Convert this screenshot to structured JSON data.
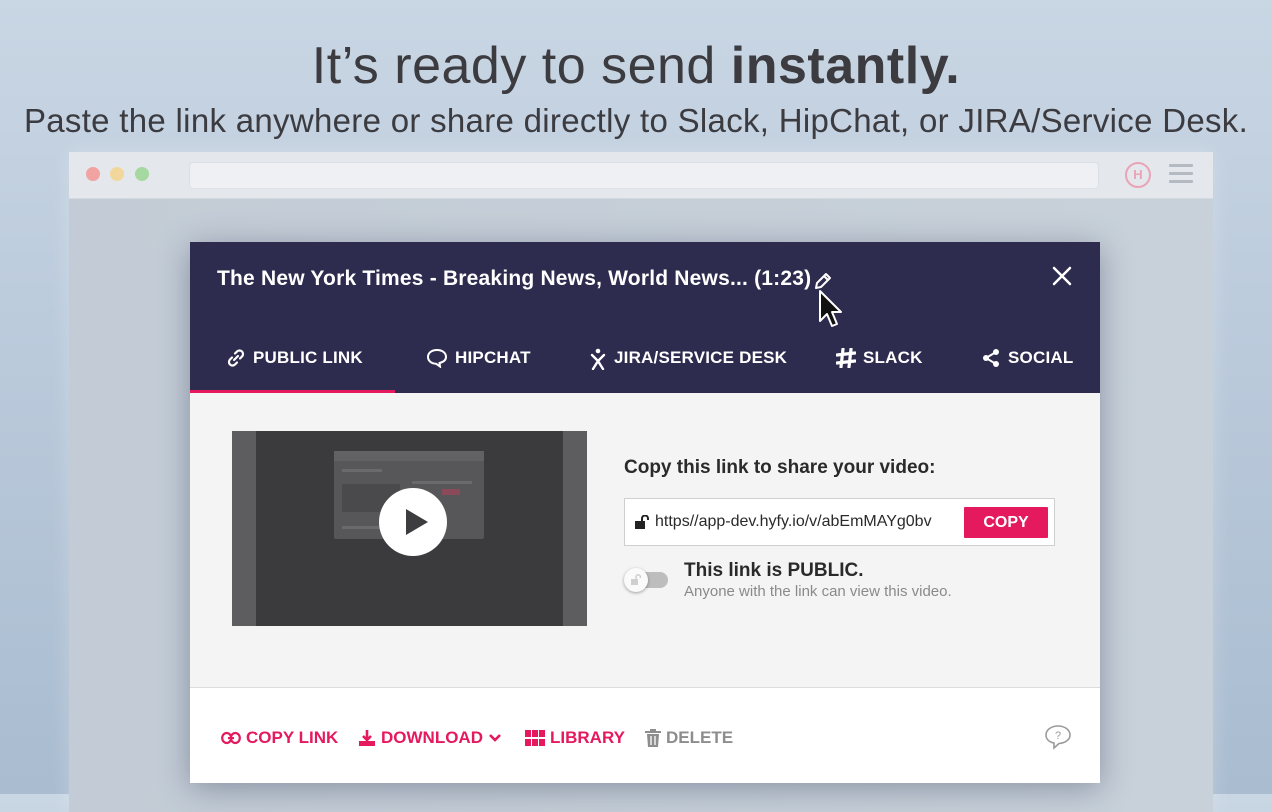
{
  "hero": {
    "title_part1": "It’s ready to send ",
    "title_bold": "instantly.",
    "subtitle": "Paste the link anywhere or share directly to Slack, HipChat, or JIRA/Service Desk."
  },
  "browser": {
    "extension_icon": "hyfy-logo-icon",
    "menu_icon": "hamburger-menu-icon"
  },
  "modal": {
    "title": "The New York Times - Breaking News, World News... (1:23)",
    "tabs": [
      {
        "label": "PUBLIC LINK",
        "icon": "link-icon",
        "active": true
      },
      {
        "label": "HIPCHAT",
        "icon": "chat-bubble-icon"
      },
      {
        "label": "JIRA/SERVICE DESK",
        "icon": "jira-icon"
      },
      {
        "label": "SLACK",
        "icon": "slack-icon"
      },
      {
        "label": "SOCIAL",
        "icon": "share-icon"
      }
    ],
    "share": {
      "heading": "Copy this link to share your video:",
      "link_value": "https//app-dev.hyfy.io/v/abEmMAYg0bv",
      "copy_label": "COPY",
      "public_title": "This link is PUBLIC.",
      "public_sub": "Anyone with the link can view this video."
    },
    "footer": {
      "copy_link": "COPY LINK",
      "download": "DOWNLOAD",
      "library": "LIBRARY",
      "delete": "DELETE"
    }
  },
  "colors": {
    "accent": "#e5195e",
    "header_bg": "#2d2b4e"
  }
}
